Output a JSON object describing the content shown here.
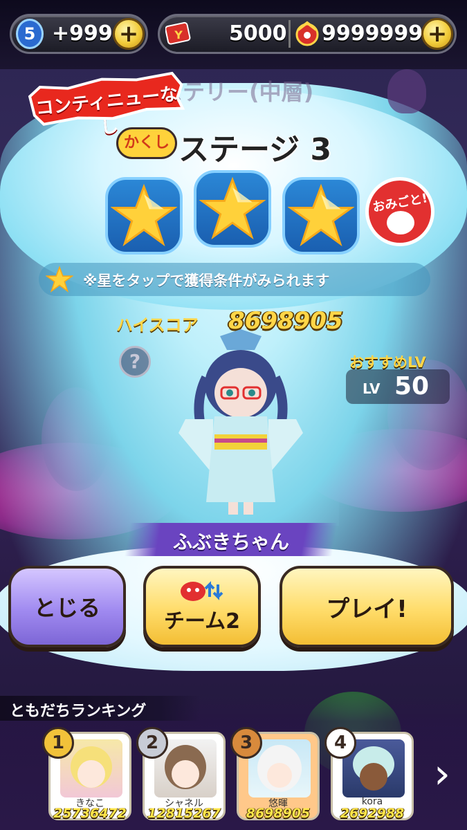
{
  "topbar": {
    "level_badge": "5",
    "stamina": "+999",
    "ticket_count": "5000",
    "money": "9999999"
  },
  "stage": {
    "chapter_title": "ミステリー(中層)",
    "no_continue": "コンティニューなし",
    "kakushi_label": "かくし",
    "stage_name": "ステージ 3",
    "stars_earned": 3,
    "stars_total": 3,
    "omigoku_label": "おみごと!",
    "hint_text": "※星をタップで獲得条件がみられます",
    "highscore_label": "ハイスコア",
    "highscore_value": "8698905",
    "help_symbol": "?",
    "recommended_label": "おすすめLV",
    "recommended_lv_prefix": "LV",
    "recommended_lv": "50"
  },
  "character": {
    "name": "ふぶきちゃん"
  },
  "buttons": {
    "close": "とじる",
    "team": "チーム2",
    "play": "プレイ!"
  },
  "ranking": {
    "title": "ともだちランキング",
    "entries": [
      {
        "rank": "1",
        "name": "きなこ",
        "score": "25736472",
        "medal_color": "#f2c23a"
      },
      {
        "rank": "2",
        "name": "シャネル",
        "score": "12815267",
        "medal_color": "#c8ccd6"
      },
      {
        "rank": "3",
        "name": "悠暉",
        "score": "8698905",
        "medal_color": "#d88a3c"
      },
      {
        "rank": "4",
        "name": "kora",
        "score": "2692988",
        "medal_color": "#ffffff"
      }
    ],
    "next_symbol": "›"
  },
  "colors": {
    "gold": "#ffd648",
    "close_button": "#a08af0",
    "play_button": "#ffdc6a",
    "badge_red": "#e23030"
  }
}
